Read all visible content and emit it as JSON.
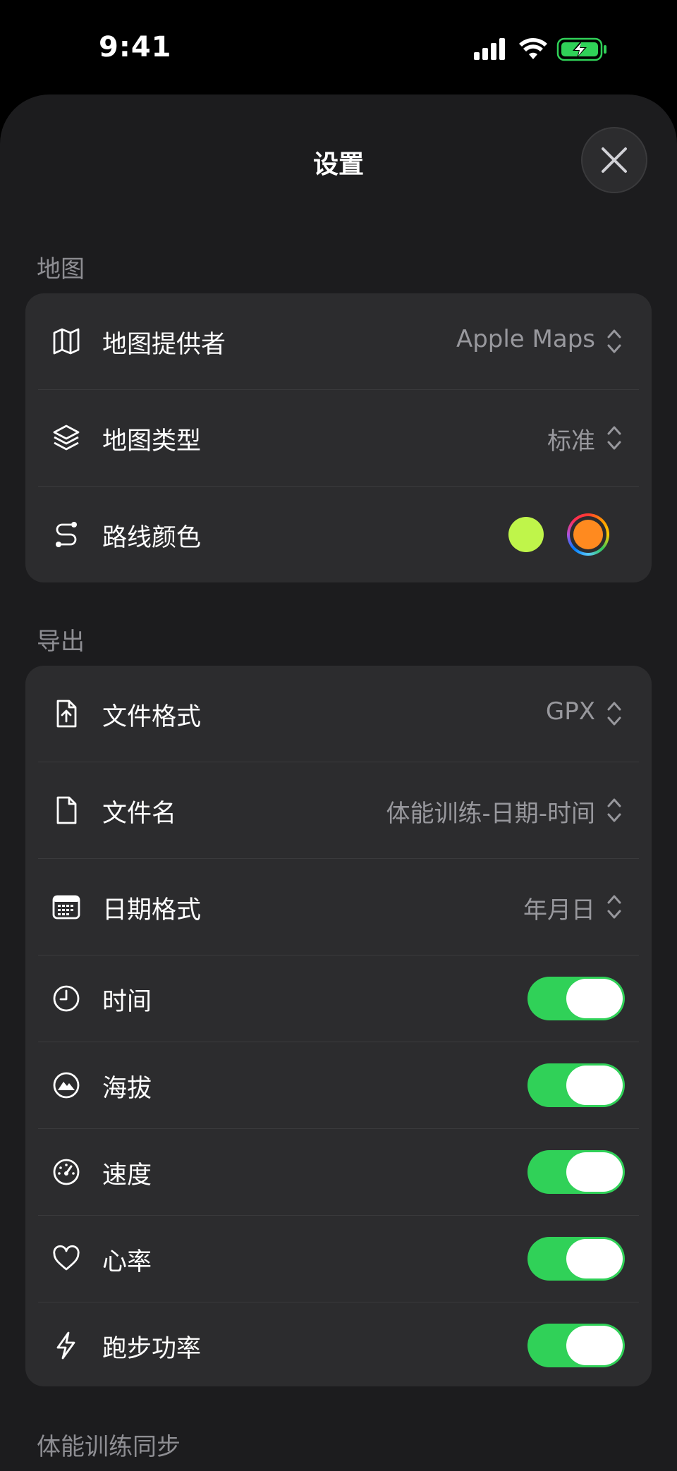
{
  "status_bar": {
    "time": "9:41"
  },
  "sheet": {
    "title": "设置",
    "close_icon": "xmark-icon"
  },
  "sections": {
    "map": {
      "header": "地图",
      "rows": {
        "provider": {
          "icon": "map-icon",
          "label": "地图提供者",
          "value": "Apple Maps"
        },
        "type": {
          "icon": "layers-icon",
          "label": "地图类型",
          "value": "标准"
        },
        "route_color": {
          "icon": "route-icon",
          "label": "路线颜色",
          "colors": [
            "#bff54a",
            "#ff8a1f"
          ]
        }
      }
    },
    "export": {
      "header": "导出",
      "rows": {
        "file_format": {
          "icon": "doc-upload-icon",
          "label": "文件格式",
          "value": "GPX"
        },
        "file_name": {
          "icon": "doc-icon",
          "label": "文件名",
          "value": "体能训练-日期-时间"
        },
        "date_format": {
          "icon": "calendar-icon",
          "label": "日期格式",
          "value": "年月日"
        },
        "time": {
          "icon": "clock-icon",
          "label": "时间",
          "enabled": true
        },
        "altitude": {
          "icon": "mountain-icon",
          "label": "海拔",
          "enabled": true
        },
        "speed": {
          "icon": "speedometer-icon",
          "label": "速度",
          "enabled": true
        },
        "heart_rate": {
          "icon": "heart-icon",
          "label": "心率",
          "enabled": true
        },
        "running_power": {
          "icon": "bolt-icon",
          "label": "跑步功率",
          "enabled": true
        }
      }
    },
    "sync": {
      "header": "体能训练同步"
    }
  },
  "colors": {
    "toggle_on": "#30d158",
    "battery": "#30d158"
  }
}
